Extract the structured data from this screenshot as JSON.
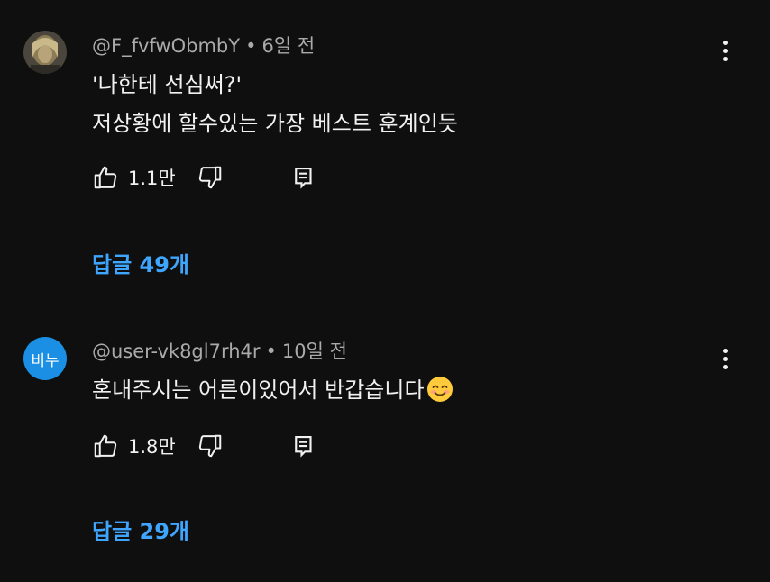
{
  "comments": [
    {
      "author": "@F_fvfwObmbY",
      "time": "6일 전",
      "lines": [
        "'나한테 선심써?'",
        "저상황에 할수있는 가장 베스트 훈계인듯"
      ],
      "likes": "1.1만",
      "replies_label": "답글 49개",
      "avatar_type": "photo",
      "avatar_colors": [
        "#3d3a35",
        "#8c7c55",
        "#c9b98a"
      ]
    },
    {
      "author": "@user-vk8gl7rh4r",
      "time": "10일 전",
      "lines": [
        "혼내주시는 어른이있어서 반갑습니다"
      ],
      "likes": "1.8만",
      "replies_label": "답글 29개",
      "avatar_type": "initials",
      "avatar_initials": "비누",
      "avatar_color": "#1a8fe3",
      "emoji": "smiling-face-emoji"
    }
  ],
  "icons": {
    "like": "thumbs-up-icon",
    "dislike": "thumbs-down-icon",
    "reply": "reply-comment-icon",
    "more": "more-vertical-icon"
  },
  "colors": {
    "background": "#0f0f0f",
    "text": "#f1f1f1",
    "meta": "#aaaaaa",
    "link": "#3ea6ff"
  }
}
